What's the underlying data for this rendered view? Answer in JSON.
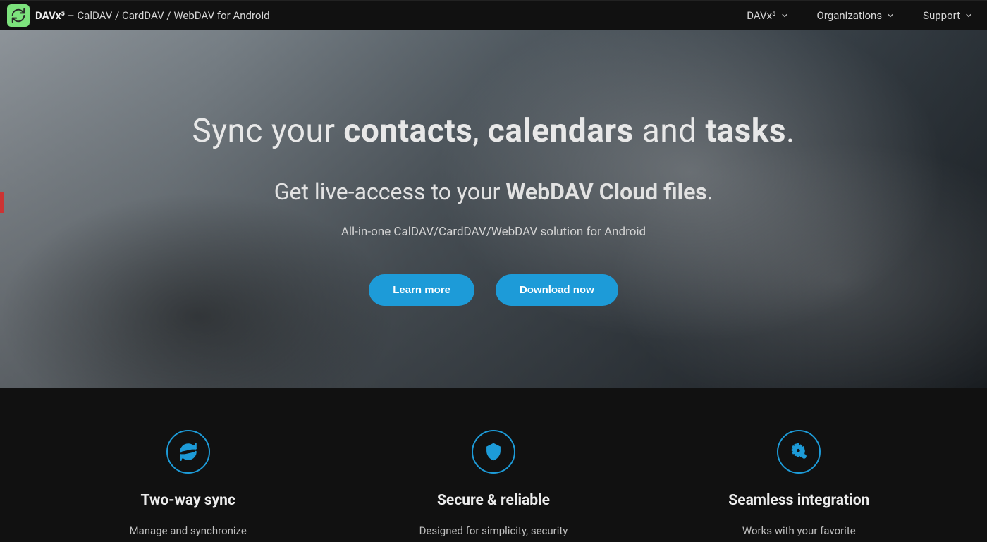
{
  "brand": {
    "name": "DAVx⁵",
    "suffix": " – CalDAV / CardDAV / WebDAV for Android"
  },
  "nav": [
    {
      "label": "DAVx⁵"
    },
    {
      "label": "Organizations"
    },
    {
      "label": "Support"
    }
  ],
  "hero": {
    "h1_pre": "Sync your ",
    "h1_b1": "contacts",
    "h1_sep1": ", ",
    "h1_b2": "calendars",
    "h1_sep2": " and ",
    "h1_b3": "tasks",
    "h1_post": ".",
    "h2_pre": "Get live-access to your ",
    "h2_b": "WebDAV Cloud files",
    "h2_post": ".",
    "tagline": "All-in-one CalDAV/CardDAV/WebDAV solution for Android",
    "btn_learn": "Learn more",
    "btn_download": "Download now"
  },
  "features": [
    {
      "title": "Two-way sync",
      "body": "Manage and synchronize"
    },
    {
      "title": "Secure & reliable",
      "body": "Designed for simplicity, security"
    },
    {
      "title": "Seamless integration",
      "body": "Works with your favorite"
    }
  ]
}
